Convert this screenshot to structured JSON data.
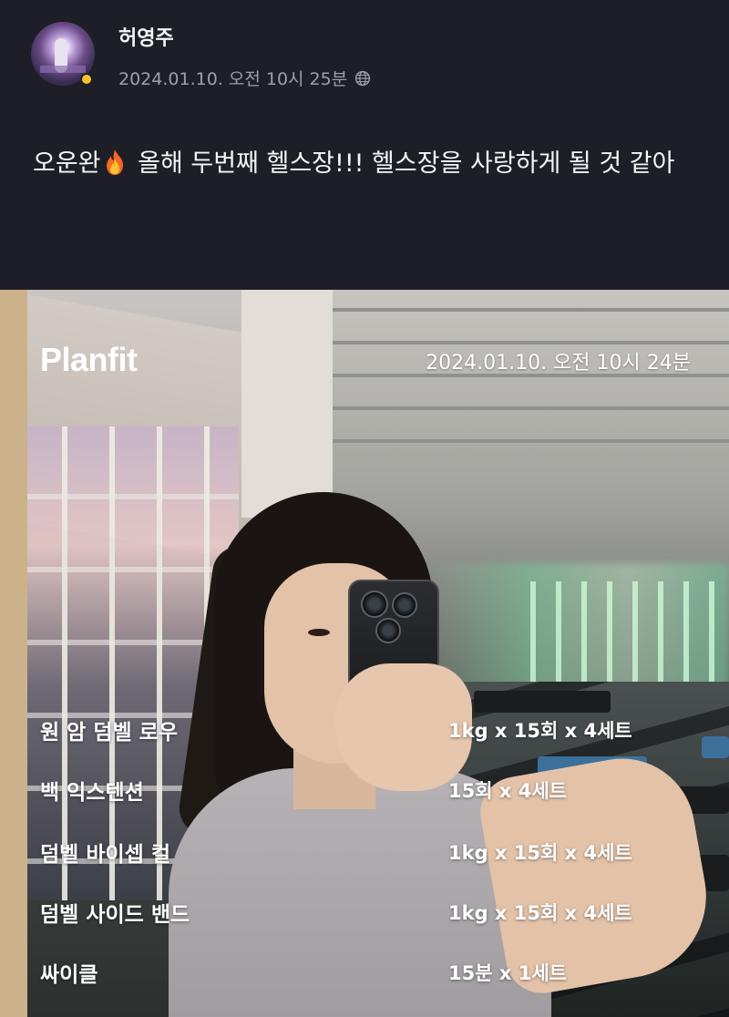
{
  "post": {
    "author": "허영주",
    "timestamp": "2024.01.10. 오전 10시 25분",
    "visibility_icon": "globe-icon",
    "text_before_emoji": "오운완",
    "emoji": "fire-emoji",
    "text_after_emoji": " 올해 두번째 헬스장!!! 헬스장을 사랑하게 될 것 같아"
  },
  "photo": {
    "brand": "Planfit",
    "date": "2024.01.10. 오전 10시 24분",
    "workouts": [
      {
        "name": "원 암 덤벨 로우",
        "sets": "1kg x 15회 x 4세트"
      },
      {
        "name": "백 익스텐션",
        "sets": "15회 x 4세트"
      },
      {
        "name": "덤벨 바이셉 컬",
        "sets": "1kg x 15회 x 4세트"
      },
      {
        "name": "덤벨 사이드 밴드",
        "sets": "1kg x 15회 x 4세트"
      },
      {
        "name": "싸이클",
        "sets": "15분 x 1세트"
      }
    ]
  },
  "colors": {
    "background": "#1e1f26",
    "online_dot": "#f7c22d",
    "meta_text": "#9ea0a8"
  }
}
